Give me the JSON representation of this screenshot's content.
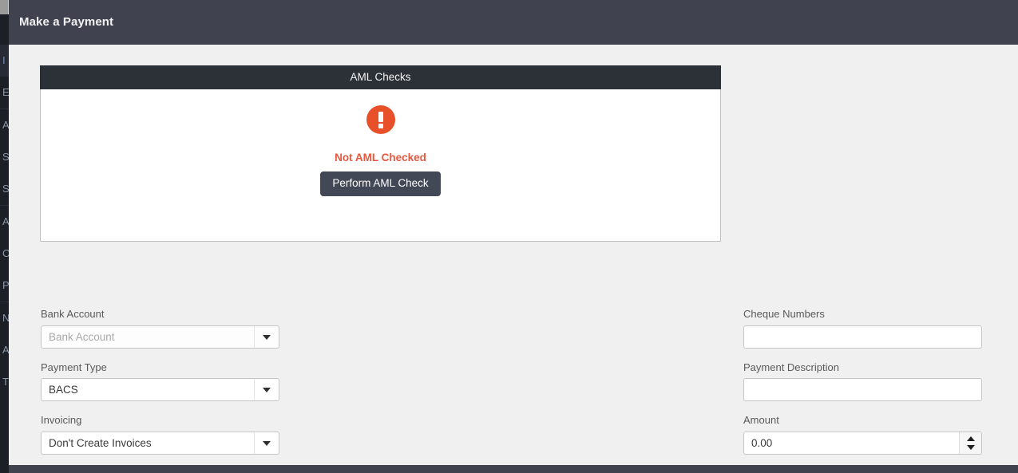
{
  "header": {
    "title": "Make a Payment"
  },
  "sidebar": {
    "items": [
      {
        "label": "I",
        "active": true
      },
      {
        "label": "E",
        "active": false
      },
      {
        "label": "A",
        "active": false
      },
      {
        "label": "S",
        "active": false
      },
      {
        "label": "S",
        "active": false
      },
      {
        "label": "A",
        "active": false
      },
      {
        "label": "C",
        "active": false
      },
      {
        "label": "P",
        "active": false
      },
      {
        "label": "N",
        "active": false
      },
      {
        "label": "A",
        "active": false
      },
      {
        "label": "T",
        "active": false
      }
    ]
  },
  "aml_panel": {
    "title": "AML Checks",
    "status_text": "Not AML Checked",
    "status_color": "#e8573f",
    "icon": "alert-exclamation-circle",
    "icon_color": "#e8502a",
    "button_label": "Perform AML Check"
  },
  "form": {
    "left": [
      {
        "name": "bank-account",
        "label": "Bank Account",
        "type": "select",
        "value": "",
        "placeholder": "Bank Account",
        "disabled": true
      },
      {
        "name": "payment-type",
        "label": "Payment Type",
        "type": "select",
        "value": "BACS",
        "placeholder": "",
        "disabled": false
      },
      {
        "name": "invoicing",
        "label": "Invoicing",
        "type": "select",
        "value": "Don't Create Invoices",
        "placeholder": "",
        "disabled": false
      }
    ],
    "right": [
      {
        "name": "cheque-numbers",
        "label": "Cheque Numbers",
        "type": "text",
        "value": "",
        "placeholder": "",
        "disabled": false
      },
      {
        "name": "payment-description",
        "label": "Payment Description",
        "type": "text",
        "value": "",
        "placeholder": "",
        "disabled": false
      },
      {
        "name": "amount",
        "label": "Amount",
        "type": "number",
        "value": "0.00",
        "placeholder": "",
        "disabled": false
      }
    ]
  }
}
